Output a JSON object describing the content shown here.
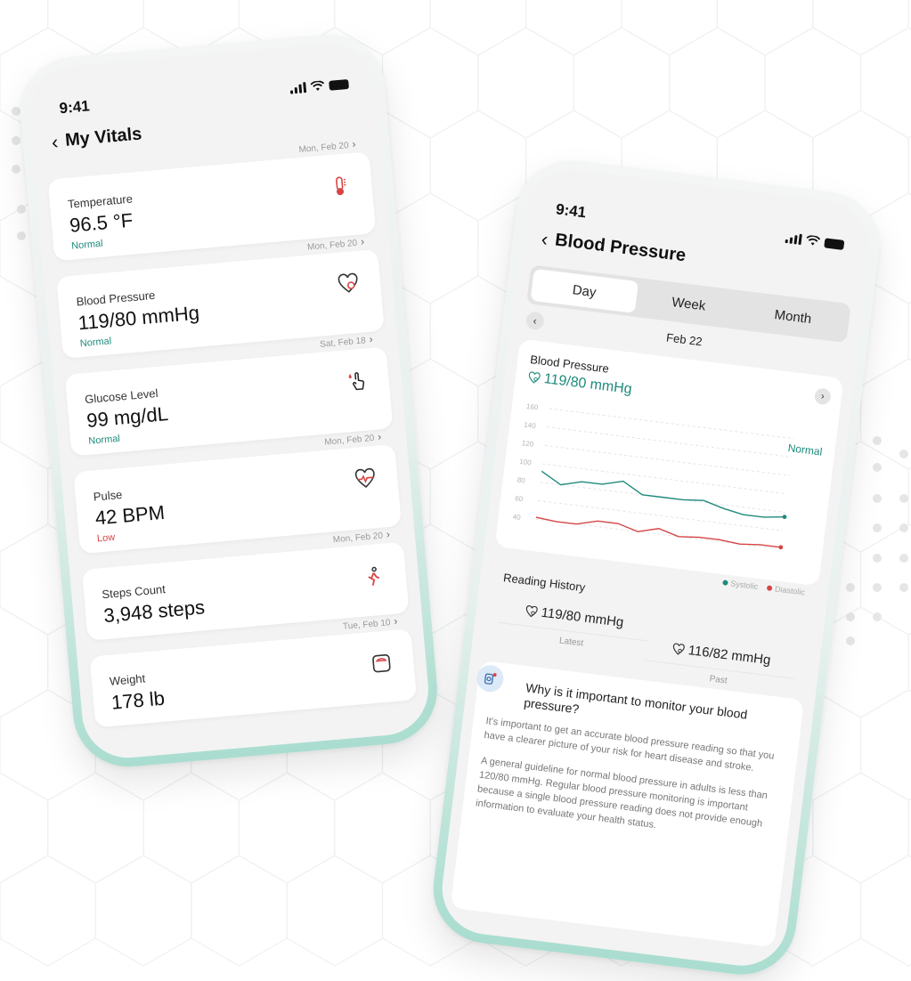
{
  "colors": {
    "accent": "#1f8a7c",
    "danger": "#d64545",
    "frame": "#a9ddcf",
    "screen": "#f3f3f3"
  },
  "vitals_screen": {
    "status_time": "9:41",
    "title": "My Vitals",
    "items": [
      {
        "name": "Temperature",
        "value": "96.5 °F",
        "status": "Normal",
        "date": "Mon, Feb 20",
        "icon": "thermometer-icon"
      },
      {
        "name": "Blood Pressure",
        "value": "119/80 mmHg",
        "status": "Normal",
        "date": "Mon, Feb 20",
        "icon": "heart-gauge-icon"
      },
      {
        "name": "Glucose Level",
        "value": "99 mg/dL",
        "status": "Normal",
        "date": "Sat, Feb 18",
        "icon": "finger-drop-icon"
      },
      {
        "name": "Pulse",
        "value": "42 BPM",
        "status": "Low",
        "date": "Mon, Feb 20",
        "icon": "heart-pulse-icon"
      },
      {
        "name": "Steps Count",
        "value": "3,948 steps",
        "status": "",
        "date": "Mon, Feb 20",
        "icon": "walking-icon"
      },
      {
        "name": "Weight",
        "value": "178 lb",
        "status": "",
        "date": "Tue, Feb 10",
        "icon": "scale-icon"
      }
    ]
  },
  "bp_screen": {
    "status_time": "9:41",
    "title": "Blood Pressure",
    "tabs": [
      "Day",
      "Week",
      "Month"
    ],
    "active_tab": "Day",
    "date": "Feb 22",
    "chart_title": "Blood Pressure",
    "current_value": "119/80 mmHg",
    "status": "Normal",
    "history_title": "Reading History",
    "latest_value": "119/80 mmHg",
    "latest_label": "Latest",
    "past_value": "116/82 mmHg",
    "past_label": "Past",
    "info_question": "Why is it important to monitor your blood pressure?",
    "info_p1": "It's important to get an accurate blood pressure reading so that you have a clearer picture of your risk for heart disease and stroke.",
    "info_p2": "A general guideline for normal blood pressure in adults is less than 120/80 mmHg. Regular blood pressure monitoring is important because a single blood pressure reading does not provide enough information to evaluate your health status."
  },
  "chart_data": {
    "type": "line",
    "ylim": [
      40,
      160
    ],
    "yticks": [
      160,
      140,
      120,
      100,
      80,
      60,
      40
    ],
    "x": [
      1,
      2,
      3,
      4,
      5,
      6,
      7,
      8,
      9,
      10,
      11,
      12,
      13
    ],
    "series": [
      {
        "name": "Systolic",
        "color": "#1f8a7c",
        "values": [
          92,
          80,
          86,
          86,
          92,
          80,
          80,
          80,
          82,
          76,
          72,
          72,
          75
        ]
      },
      {
        "name": "Diastolic",
        "color": "#d64545",
        "values": [
          42,
          40,
          40,
          46,
          46,
          40,
          46,
          40,
          42,
          42,
          40,
          42,
          42
        ]
      }
    ]
  }
}
